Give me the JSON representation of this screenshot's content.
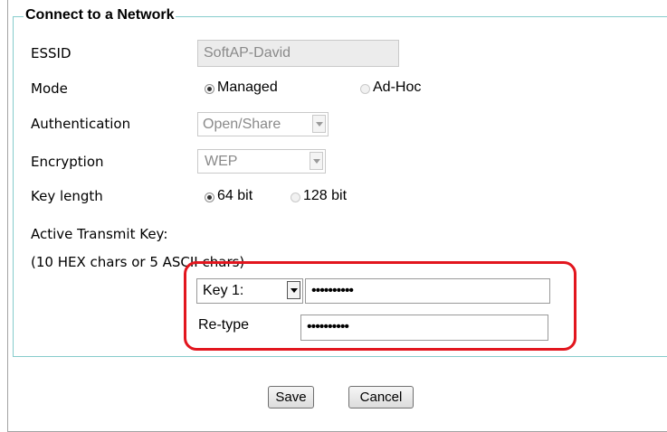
{
  "form": {
    "legend": "Connect to a Network",
    "essid": {
      "label": "ESSID",
      "value": "SoftAP-David"
    },
    "mode": {
      "label": "Mode",
      "options": [
        {
          "label": "Managed",
          "checked": true,
          "disabled": false
        },
        {
          "label": "Ad-Hoc",
          "checked": false,
          "disabled": true
        }
      ]
    },
    "authentication": {
      "label": "Authentication",
      "value": "Open/Share"
    },
    "encryption": {
      "label": "Encryption",
      "value": "WEP"
    },
    "key_length": {
      "label": "Key length",
      "options": [
        {
          "label": "64 bit",
          "checked": true,
          "disabled": false
        },
        {
          "label": "128 bit",
          "checked": false,
          "disabled": true
        }
      ]
    },
    "transmit_key": {
      "label": "Active Transmit Key:",
      "hint": "(10 HEX chars or 5 ASCII chars)",
      "key_select": "Key 1:",
      "key_value": "••••••••••",
      "retype_label": "Re-type",
      "retype_value": "••••••••••"
    }
  },
  "buttons": {
    "save": "Save",
    "cancel": "Cancel"
  },
  "colors": {
    "highlight": "#e2161e",
    "fieldset_border": "#86cccc"
  }
}
